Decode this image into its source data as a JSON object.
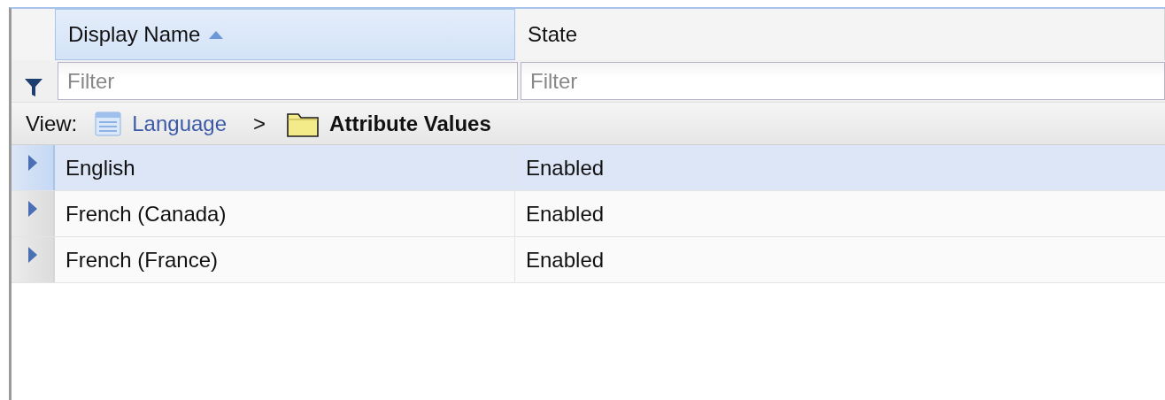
{
  "table": {
    "columns": [
      {
        "label": "Display Name",
        "sorted": true,
        "filter_placeholder": "Filter"
      },
      {
        "label": "State",
        "sorted": false,
        "filter_placeholder": "Filter"
      }
    ],
    "breadcrumb": {
      "label": "View:",
      "items": [
        {
          "kind": "list",
          "text": "Language",
          "link": true
        },
        {
          "kind": "folder",
          "text": "Attribute Values",
          "link": false
        }
      ],
      "separator": ">"
    },
    "rows": [
      {
        "display_name": "English",
        "state": "Enabled",
        "selected": true
      },
      {
        "display_name": "French (Canada)",
        "state": "Enabled",
        "selected": false
      },
      {
        "display_name": "French (France)",
        "state": "Enabled",
        "selected": false
      }
    ]
  }
}
